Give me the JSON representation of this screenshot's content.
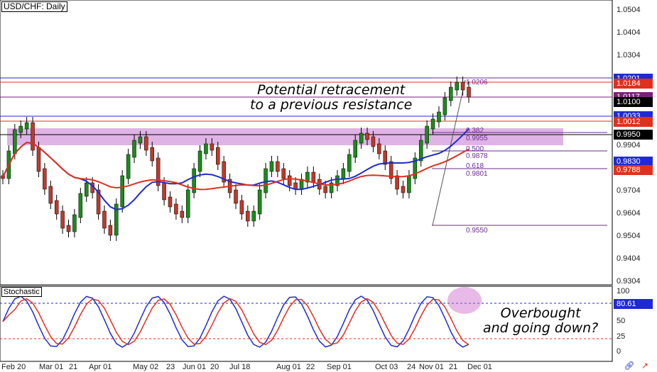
{
  "chart_title": "USD/CHF: Daily",
  "indicator_label": "Stochastic",
  "annotation_resistance": [
    "Potential retracement",
    "to a previous resistance"
  ],
  "annotation_stochastic": [
    "Overbought",
    "and going down?"
  ],
  "price_axis": [
    "1.0504",
    "1.0404",
    "1.0304",
    "1.0201",
    "1.0184",
    "1.0117",
    "1.0100",
    "1.0033",
    "1.0012",
    "0.9950",
    "0.9904",
    "0.9830",
    "0.9788",
    "0.9704",
    "0.9604",
    "0.9504",
    "0.9404",
    "0.9304"
  ],
  "price_tags": [
    {
      "text": "1.0201",
      "bg": "#1f2bd1",
      "fg": "#ffffff"
    },
    {
      "text": "1.0184",
      "bg": "#e0301e",
      "fg": "#ffffff"
    },
    {
      "text": "1.0117",
      "bg": "#7a1f7a",
      "fg": "#ffffff"
    },
    {
      "text": "1.0100",
      "bg": "#000000",
      "fg": "#ffffff"
    },
    {
      "text": "1.0033",
      "bg": "#1f2bd1",
      "fg": "#ffffff"
    },
    {
      "text": "1.0012",
      "bg": "#e0301e",
      "fg": "#ffffff"
    },
    {
      "text": "0.9950",
      "bg": "#000000",
      "fg": "#ffffff"
    },
    {
      "text": "0.9830",
      "bg": "#1f2bd1",
      "fg": "#ffffff"
    },
    {
      "text": "0.9788",
      "bg": "#e0301e",
      "fg": "#ffffff"
    }
  ],
  "stoch_axis": [
    "100",
    "80.61",
    "50",
    "25",
    "0"
  ],
  "fib_labels": [
    "1.0206",
    "0.382",
    "0.9955",
    "0.500",
    "0.9878",
    "0.618",
    "0.9801",
    "0.9550"
  ],
  "date_axis": [
    "Feb",
    "20",
    "Mar 01",
    "21",
    "Apr 01",
    "May 02",
    "23",
    "Jun 01",
    "20",
    "Jul 18",
    "Aug 01",
    "22",
    "Sep 01",
    "Oct 03",
    "24",
    "Nov 01",
    "21",
    "Dec 01"
  ],
  "colors": {
    "bull": "#1a8c1a",
    "bear": "#c0392b",
    "ma_fast": "#1f2bd1",
    "ma_slow": "#e0301e",
    "resistance_zone": "#d9a6e0",
    "stoch_k": "#1f2bd1",
    "stoch_d": "#e0301e"
  },
  "icons": [
    "link-icon",
    "arrow-icon"
  ]
}
